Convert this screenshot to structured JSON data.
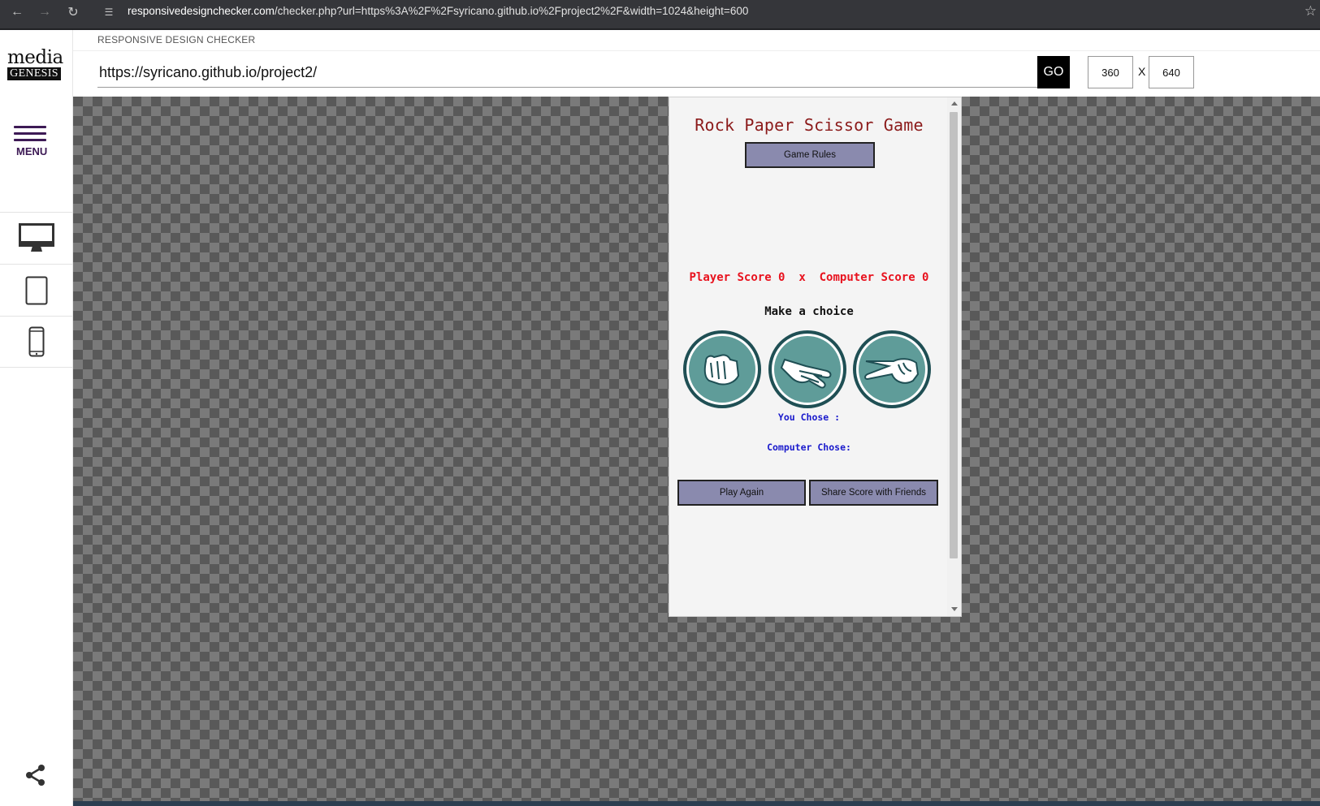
{
  "browser": {
    "url_host": "responsivedesignchecker.com",
    "url_path": "/checker.php?url=https%3A%2F%2Fsyricano.github.io%2Fproject2%2F&width=1024&height=600"
  },
  "sidebar": {
    "logo_line1": "media",
    "logo_line2": "GENESIS",
    "menu_label": "MENU",
    "devices": [
      "desktop-icon",
      "tablet-icon",
      "phone-icon"
    ]
  },
  "header": {
    "title": "RESPONSIVE DESIGN CHECKER",
    "url_value": "https://syricano.github.io/project2/",
    "go_label": "GO",
    "width_value": "360",
    "separator": "X",
    "height_value": "640"
  },
  "game": {
    "title": "Rock Paper Scissor Game",
    "rules_button": "Game Rules",
    "score_line": "Player Score 0  x  Computer Score 0",
    "choice_heading": "Make a choice",
    "choices": [
      "rock-icon",
      "paper-icon",
      "scissors-icon"
    ],
    "you_chose": "You Chose :",
    "computer_chose": "Computer Chose:",
    "play_again_button": "Play Again",
    "share_button": "Share Score with Friends"
  },
  "colors": {
    "accent_purple": "#3d1a55",
    "title_red": "#8b1a1a",
    "score_red": "#e8121e",
    "result_blue": "#1a1acc",
    "button_fill": "#8a8aae",
    "choice_teal": "#5f9c99",
    "choice_ring": "#1f4f54"
  }
}
